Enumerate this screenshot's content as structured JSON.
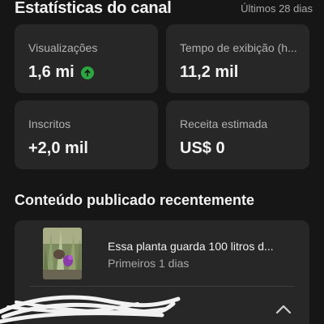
{
  "header": {
    "title": "Estatísticas do canal",
    "period": "Últimos 28 dias"
  },
  "metrics": [
    {
      "label": "Visualizações",
      "value": "1,6 mi",
      "trend": "up",
      "trend_icon": "arrow-up-circle-icon"
    },
    {
      "label": "Tempo de exibição (h...",
      "value": "11,2 mil"
    },
    {
      "label": "Inscritos",
      "value": "+2,0 mil"
    },
    {
      "label": "Receita estimada",
      "value": "US$ 0"
    }
  ],
  "recent_content": {
    "section_title": "Conteúdo publicado recentemente",
    "items": [
      {
        "title": "Essa planta guarda 100 litros d...",
        "meta": "Primeiros 1 dias",
        "thumbnail": "plant-thumbnail"
      }
    ],
    "expand_icon": "chevron-up-icon"
  },
  "colors": {
    "background": "#161616",
    "card": "#272727",
    "trend_up": "#2ba640",
    "secondary_text": "#a8a8a8"
  }
}
